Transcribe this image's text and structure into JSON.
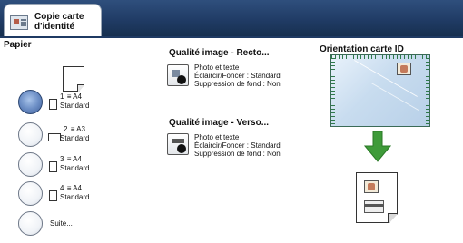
{
  "tab": {
    "title_line1": "Copie carte",
    "title_line2": "d'identité",
    "icon": "id-card-icon"
  },
  "paper": {
    "title": "Papier",
    "options": [
      {
        "line1_prefix": "1",
        "tray_glyph": "≡",
        "size": "A4",
        "line2": "Standard",
        "selected": true
      },
      {
        "line1_prefix": "2",
        "tray_glyph": "≡",
        "size": "A3",
        "line2": "Standard",
        "selected": false
      },
      {
        "line1_prefix": "3",
        "tray_glyph": "≡",
        "size": "A4",
        "line2": "Standard",
        "selected": false
      },
      {
        "line1_prefix": "4",
        "tray_glyph": "≡",
        "size": "A4",
        "line2": "Standard",
        "selected": false
      }
    ],
    "more": "Suite..."
  },
  "quality_front": {
    "title": "Qualité image - Recto...",
    "line1": "Photo et texte",
    "line2": "Éclaircir/Foncer : Standard",
    "line3": "Suppression de fond : Non"
  },
  "quality_back": {
    "title": "Qualité image - Verso...",
    "line1": "Photo et texte",
    "line2": "Éclaircir/Foncer : Standard",
    "line3": "Suppression de fond : Non"
  },
  "orientation": {
    "title": "Orientation carte ID",
    "arrow_color": "#3f9b3a"
  },
  "colors": {
    "topbar": "#1f3a63",
    "selected_radio": "#6d8fc6"
  }
}
